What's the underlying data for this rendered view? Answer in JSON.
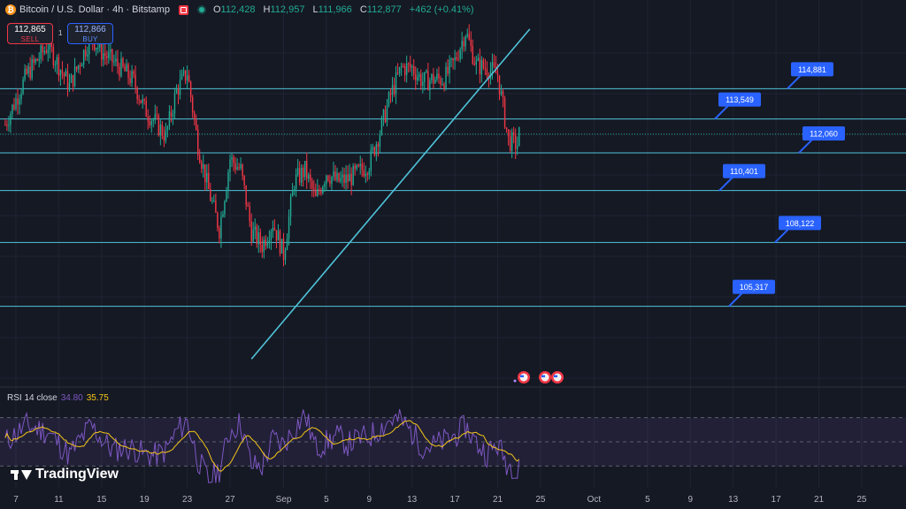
{
  "header": {
    "coin_symbol": "₿",
    "title": "Bitcoin / U.S. Dollar · 4h · Bitstamp",
    "ohlc": [
      {
        "k": "O",
        "v": "112,428"
      },
      {
        "k": "H",
        "v": "112,957"
      },
      {
        "k": "L",
        "v": "111,966"
      },
      {
        "k": "C",
        "v": "112,877"
      },
      {
        "k": "",
        "v": "+462 (+0.41%)"
      }
    ]
  },
  "trade": {
    "sell_price": "112,865",
    "sell_label": "SELL",
    "spread": "1",
    "buy_price": "112,866",
    "buy_label": "BUY"
  },
  "rsi": {
    "label": "RSI 14 close",
    "value": "34.80",
    "ma_value": "35.75"
  },
  "brand": {
    "name": "TradingView"
  },
  "colors": {
    "up": "#22ab94",
    "down": "#f23645",
    "level_line": "#4fc3d9",
    "label_bg": "#2962ff",
    "rsi_line": "#7e57c2",
    "rsi_ma": "#f5c518",
    "background": "#151924"
  },
  "chart_data": {
    "type": "candlestick",
    "symbol": "BTCUSD",
    "interval": "4h",
    "x_ticks": [
      "7",
      "11",
      "15",
      "19",
      "23",
      "27",
      "Sep",
      "5",
      "9",
      "13",
      "17",
      "21",
      "25",
      "Oct",
      "5",
      "9",
      "13",
      "17",
      "21",
      "25"
    ],
    "ylim": [
      102000,
      118000
    ],
    "levels": [
      114881,
      113549,
      112060,
      110401,
      108122,
      105317
    ],
    "level_labels": [
      "114,881",
      "113,549",
      "112,060",
      "110,401",
      "108,122",
      "105,317"
    ],
    "trendline": {
      "from": [
        "Aug 29",
        103000
      ],
      "to": [
        "Sep 24",
        117500
      ]
    },
    "close_path": [
      [
        "Aug 6",
        113300
      ],
      [
        "Aug 8",
        115500
      ],
      [
        "Aug 10",
        116800
      ],
      [
        "Aug 12",
        115000
      ],
      [
        "Aug 14",
        117200
      ],
      [
        "Aug 15",
        116500
      ],
      [
        "Aug 17",
        115700
      ],
      [
        "Aug 18",
        115200
      ],
      [
        "Aug 19",
        114000
      ],
      [
        "Aug 21",
        112800
      ],
      [
        "Aug 22",
        114800
      ],
      [
        "Aug 23",
        115600
      ],
      [
        "Aug 24",
        112400
      ],
      [
        "Aug 25",
        110400
      ],
      [
        "Aug 26",
        108700
      ],
      [
        "Aug 27",
        111800
      ],
      [
        "Aug 28",
        111300
      ],
      [
        "Aug 29",
        108600
      ],
      [
        "Aug 30",
        108000
      ],
      [
        "Aug 31",
        109000
      ],
      [
        "Sep 1",
        107600
      ],
      [
        "Sep 2",
        110800
      ],
      [
        "Sep 3",
        111300
      ],
      [
        "Sep 4",
        110000
      ],
      [
        "Sep 5",
        111200
      ],
      [
        "Sep 6",
        110800
      ],
      [
        "Sep 7",
        110900
      ],
      [
        "Sep 8",
        111200
      ],
      [
        "Sep 9",
        111600
      ],
      [
        "Sep 10",
        113000
      ],
      [
        "Sep 11",
        114600
      ],
      [
        "Sep 12",
        115800
      ],
      [
        "Sep 13",
        115800
      ],
      [
        "Sep 14",
        115200
      ],
      [
        "Sep 15",
        115300
      ],
      [
        "Sep 16",
        115300
      ],
      [
        "Sep 17",
        116100
      ],
      [
        "Sep 18",
        117400
      ],
      [
        "Sep 19",
        115900
      ],
      [
        "Sep 20",
        115800
      ],
      [
        "Sep 21",
        115500
      ],
      [
        "Sep 22",
        112600
      ],
      [
        "Sep 22 20h",
        112420
      ],
      [
        "Sep 23",
        112877
      ]
    ],
    "rsi_range": [
      0,
      100
    ],
    "rsi_bands": [
      70,
      50,
      30
    ],
    "rsi_last": 34.8,
    "rsi_ma_last": 35.75,
    "annotations": [
      "event-flags-us"
    ]
  }
}
